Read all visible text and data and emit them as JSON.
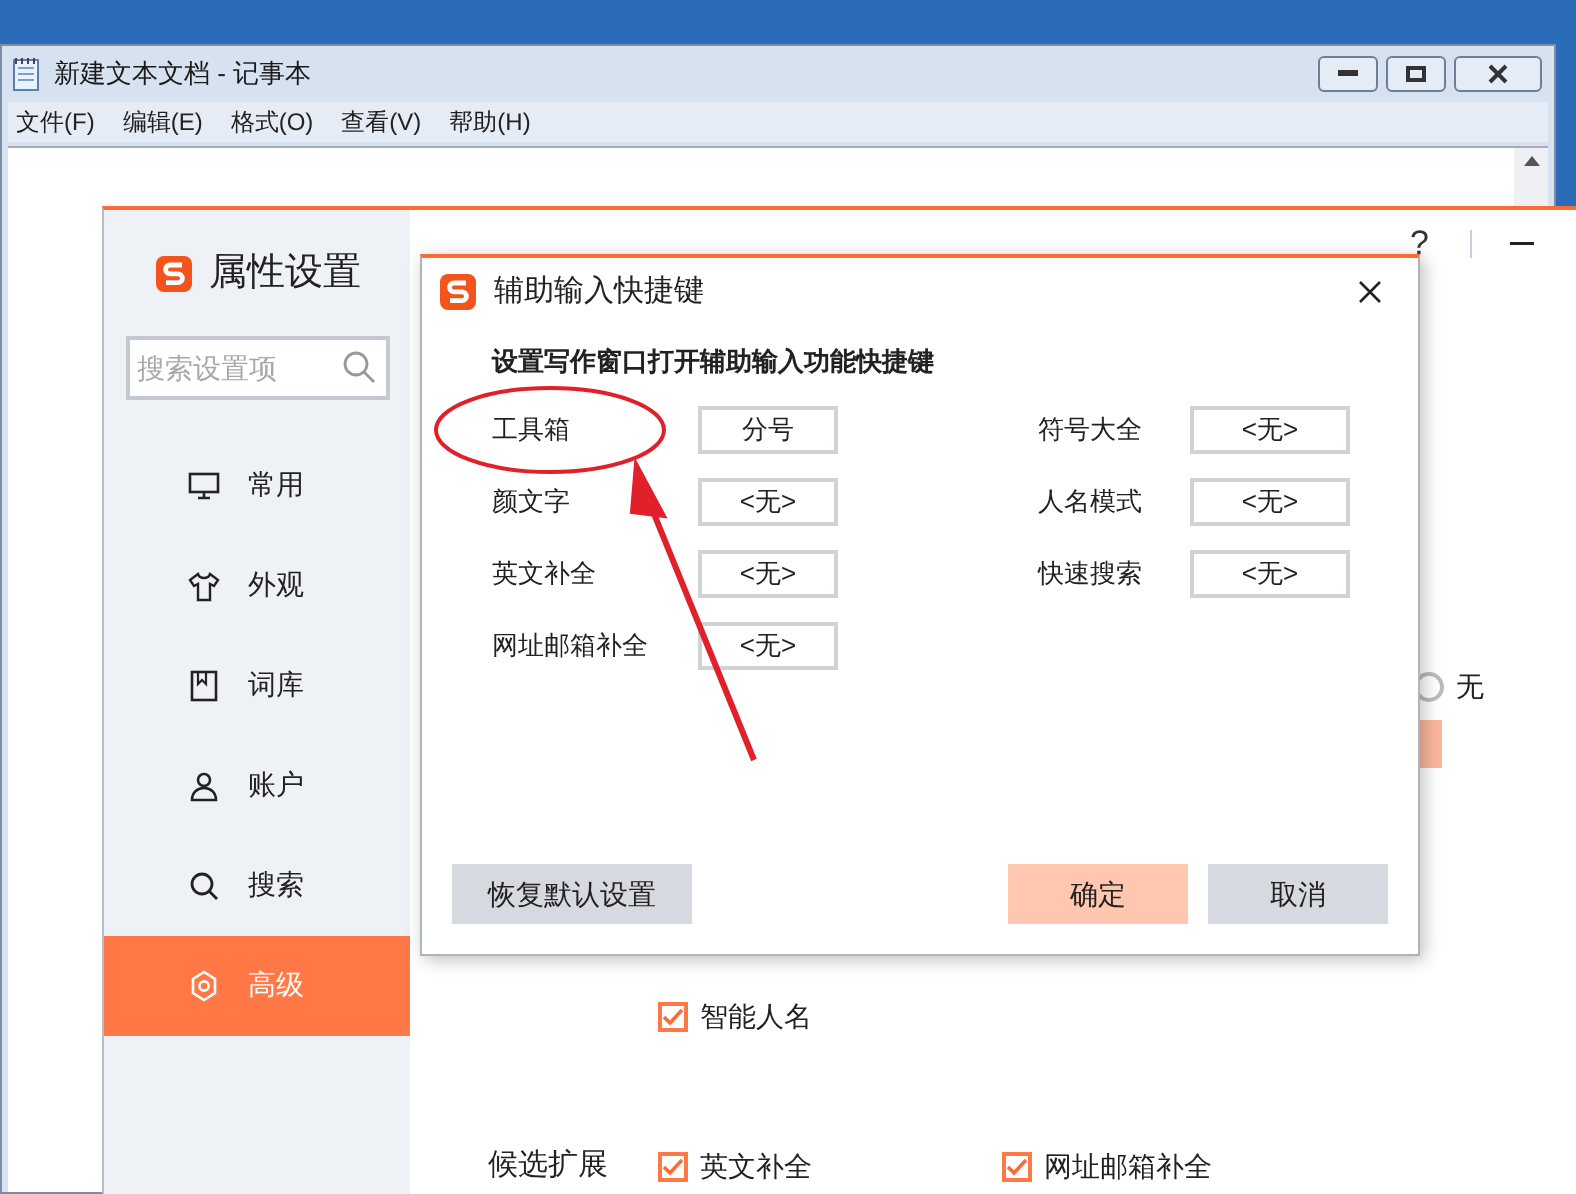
{
  "notepad": {
    "title": "新建文本文档 - 记事本",
    "menu": [
      "文件(F)",
      "编辑(E)",
      "格式(O)",
      "查看(V)",
      "帮助(H)"
    ]
  },
  "settings": {
    "title": "属性设置",
    "search": {
      "placeholder": "搜索设置项"
    },
    "help": "?",
    "nav": [
      {
        "label": "常用",
        "selected": false
      },
      {
        "label": "外观",
        "selected": false
      },
      {
        "label": "词库",
        "selected": false
      },
      {
        "label": "账户",
        "selected": false
      },
      {
        "label": "搜索",
        "selected": false
      },
      {
        "label": "高级",
        "selected": true
      }
    ],
    "radio": {
      "label": "无",
      "selected": false
    },
    "checkboxes": [
      {
        "label": "智能人名",
        "checked": true
      }
    ],
    "candidate_extension": {
      "label": "候选扩展",
      "options": [
        {
          "label": "英文补全",
          "checked": true
        },
        {
          "label": "网址邮箱补全",
          "checked": true
        }
      ]
    }
  },
  "dialog": {
    "title": "辅助输入快捷键",
    "subtitle": "设置写作窗口打开辅助输入功能快捷键",
    "left": [
      {
        "label": "工具箱",
        "key": "分号"
      },
      {
        "label": "颜文字",
        "key": "<无>"
      },
      {
        "label": "英文补全",
        "key": "<无>"
      },
      {
        "label": "网址邮箱补全",
        "key": "<无>"
      }
    ],
    "right": [
      {
        "label": "符号大全",
        "key": "<无>"
      },
      {
        "label": "人名模式",
        "key": "<无>"
      },
      {
        "label": "快速搜索",
        "key": "<无>"
      }
    ],
    "buttons": [
      {
        "label": "恢复默认设置",
        "kind": "secondary"
      },
      {
        "label": "确定",
        "kind": "primary"
      },
      {
        "label": "取消",
        "kind": "secondary"
      }
    ]
  }
}
